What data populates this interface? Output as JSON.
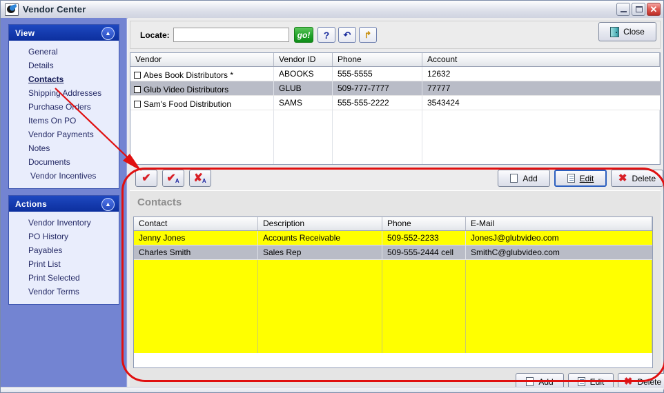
{
  "window": {
    "title": "Vendor Center",
    "icon": "app-logo-icon",
    "minimize_label": "_",
    "maximize_label": "□",
    "close_label": "✕"
  },
  "sidebar": {
    "view_panel": {
      "title": "View",
      "collapse_icon": "chevron-up-icon",
      "items": [
        {
          "label": "General",
          "active": false
        },
        {
          "label": "Details",
          "active": false
        },
        {
          "label": "Contacts",
          "active": true
        },
        {
          "label": "Shipping Addresses",
          "active": false
        },
        {
          "label": "Purchase Orders",
          "active": false
        },
        {
          "label": "Items On PO",
          "active": false
        },
        {
          "label": "Vendor Payments",
          "active": false
        },
        {
          "label": "Notes",
          "active": false
        },
        {
          "label": "Documents",
          "active": false
        },
        {
          "label": "Vendor Incentives",
          "active": false
        }
      ]
    },
    "actions_panel": {
      "title": "Actions",
      "collapse_icon": "chevron-up-icon",
      "items": [
        {
          "label": "Vendor Inventory"
        },
        {
          "label": "PO History"
        },
        {
          "label": "Payables"
        },
        {
          "label": "Print List"
        },
        {
          "label": "Print Selected"
        },
        {
          "label": "Vendor Terms"
        }
      ]
    }
  },
  "toolbar": {
    "locate_label": "Locate:",
    "locate_value": "",
    "locate_placeholder": "",
    "go_label": "go!",
    "help_label": "?",
    "refresh_label": "↶",
    "export_label": "↱",
    "close_label": "Close"
  },
  "vendor_grid": {
    "columns": [
      "Vendor",
      "Vendor ID",
      "Phone",
      "Account"
    ],
    "sort_column": "Vendor",
    "sort_direction": "ascending",
    "rows": [
      {
        "vendor": "Abes Book Distributors *",
        "vendor_id": "ABOOKS",
        "phone": "555-5555",
        "account": "12632",
        "selected": false,
        "checked": false
      },
      {
        "vendor": "Glub Video Distributors",
        "vendor_id": "GLUB",
        "phone": "509-777-7777",
        "account": "77777",
        "selected": true,
        "checked": false
      },
      {
        "vendor": "Sam's Food Distribution",
        "vendor_id": "SAMS",
        "phone": "555-555-2222",
        "account": "3543424",
        "selected": false,
        "checked": false
      }
    ]
  },
  "vendor_actions": {
    "check_one_label": "✔",
    "check_all_label": "✔",
    "check_all_sub": "A",
    "uncheck_all_label": "✘",
    "uncheck_all_sub": "A",
    "add_label": "Add",
    "edit_label": "Edit",
    "edit_accel": "E",
    "delete_label": "Delete"
  },
  "contacts": {
    "title": "Contacts",
    "columns": [
      "Contact",
      "Description",
      "Phone",
      "E-Mail"
    ],
    "rows": [
      {
        "contact": "Jenny Jones",
        "description": "Accounts Receivable",
        "phone": "509-552-2233",
        "email": "JonesJ@glubvideo.com",
        "selected": false
      },
      {
        "contact": "Charles Smith",
        "description": "Sales Rep",
        "phone": "509-555-2444 cell",
        "email": "SmithC@glubvideo.com",
        "selected": true
      }
    ],
    "add_label": "Add",
    "edit_label": "Edit",
    "delete_label": "Delete"
  },
  "annotation": {
    "highlight_color": "#e01010",
    "shape": "oval-callout",
    "arrow": "arrow-from-contacts-link"
  }
}
